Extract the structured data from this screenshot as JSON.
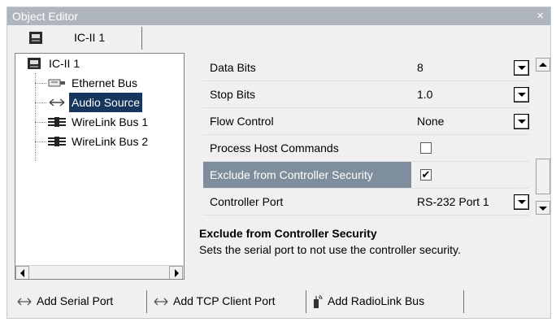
{
  "window": {
    "title": "Object Editor",
    "close_glyph": "×"
  },
  "tab": {
    "label": "IC-II 1",
    "icon": "device-icon"
  },
  "tree": {
    "root": {
      "label": "IC-II 1",
      "icon": "device-icon"
    },
    "children": [
      {
        "label": "Ethernet Bus",
        "icon": "ethernet-icon",
        "selected": false
      },
      {
        "label": "Audio Source",
        "icon": "serial-port-icon",
        "selected": true
      },
      {
        "label": "WireLink Bus 1",
        "icon": "wirelink-icon",
        "selected": false
      },
      {
        "label": "WireLink Bus 2",
        "icon": "wirelink-icon",
        "selected": false
      }
    ]
  },
  "properties": [
    {
      "name": "Data Bits",
      "value": "8",
      "control": "combo"
    },
    {
      "name": "Stop Bits",
      "value": "1.0",
      "control": "combo"
    },
    {
      "name": "Flow Control",
      "value": "None",
      "control": "combo"
    },
    {
      "name": "Process Host Commands",
      "checked": false,
      "control": "checkbox"
    },
    {
      "name": "Exclude from Controller Security",
      "checked": true,
      "control": "checkbox",
      "selected": true
    },
    {
      "name": "Controller Port",
      "value": "RS-232 Port 1",
      "control": "combo"
    }
  ],
  "description": {
    "title": "Exclude from Controller Security",
    "text": "Sets the serial port to not use the controller security."
  },
  "buttons": [
    {
      "label": "Add Serial Port",
      "icon": "serial-port-icon"
    },
    {
      "label": "Add TCP Client Port",
      "icon": "serial-port-icon"
    },
    {
      "label": "Add RadioLink Bus",
      "icon": "radiolink-icon"
    }
  ],
  "colors": {
    "title_bar": "#aeb5bc",
    "tree_selection": "#17365d",
    "grid_selection": "#7f8e9c"
  }
}
